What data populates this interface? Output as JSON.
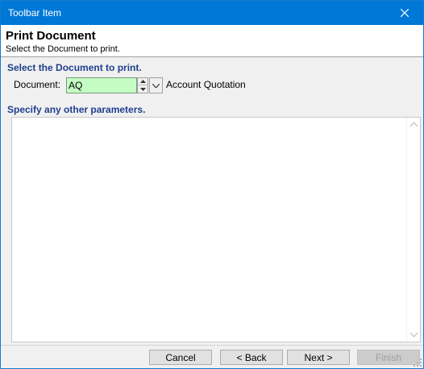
{
  "window": {
    "title": "Toolbar Item"
  },
  "header": {
    "title": "Print Document",
    "subtitle": "Select the Document to print."
  },
  "document_section": {
    "heading": "Select the Document to print.",
    "field_label": "Document:",
    "field_value": "AQ",
    "description": "Account Quotation"
  },
  "params_section": {
    "heading": "Specify any other parameters."
  },
  "buttons": {
    "cancel": "Cancel",
    "back": "< Back",
    "next": "Next >",
    "finish": "Finish"
  },
  "colors": {
    "titlebar": "#0078d7",
    "section_heading": "#1f3f8f",
    "input_background": "#c4fcc4"
  },
  "icons": [
    "close-icon",
    "spin-up-icon",
    "spin-down-icon",
    "chevron-down-icon",
    "scroll-up-icon",
    "scroll-down-icon",
    "resize-grip-icon"
  ]
}
